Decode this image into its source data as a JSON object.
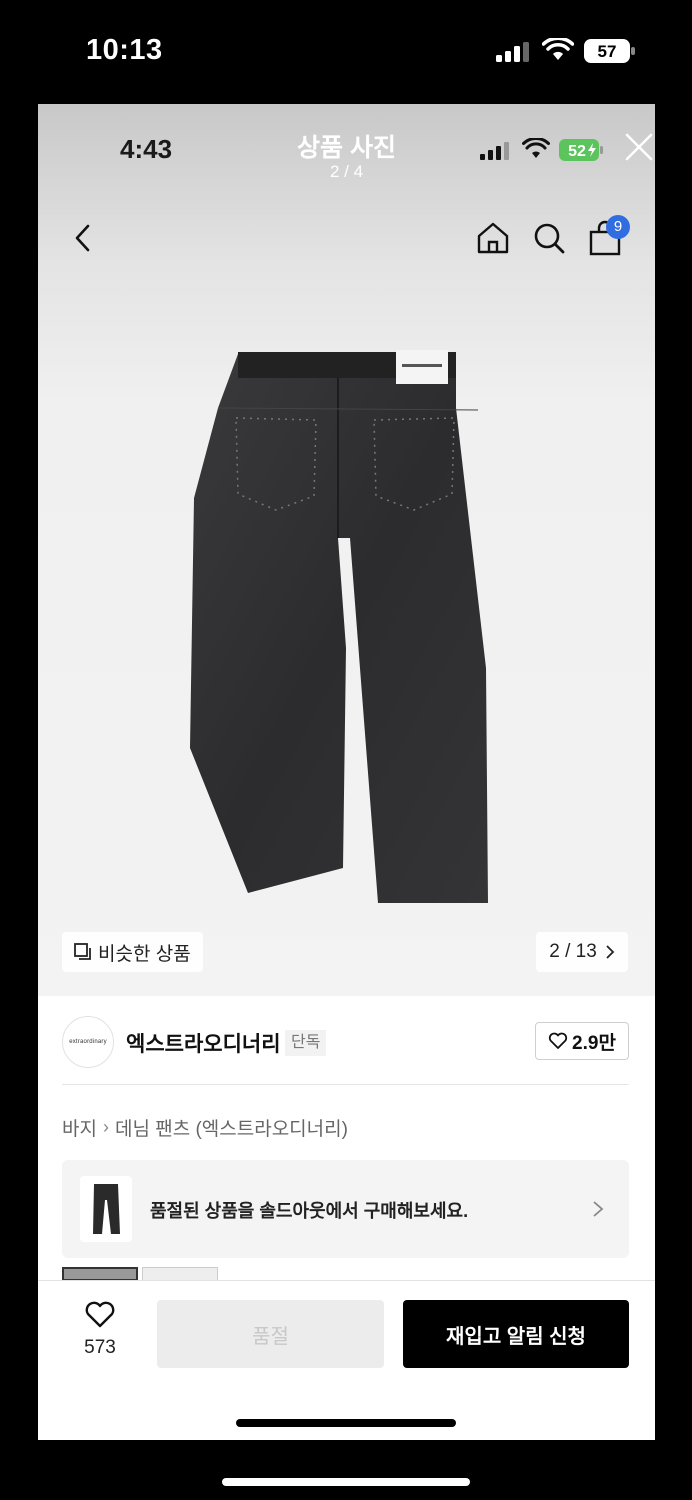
{
  "outer_status": {
    "time": "10:13",
    "battery": "57"
  },
  "inner_status": {
    "time": "4:43",
    "battery": "52"
  },
  "viewer": {
    "title": "상품 사진",
    "counter": "2 / 4"
  },
  "header": {
    "cart_count": "9"
  },
  "photo": {
    "similar_label": "비슷한 상품",
    "photo_counter": "2 / 13"
  },
  "brand": {
    "logo_text": "extraordinary",
    "name": "엑스트라오디너리",
    "tag": "단독",
    "likes": "2.9만"
  },
  "breadcrumb": [
    "바지",
    "데님 팬츠 (엑스트라오디너리)"
  ],
  "banner": {
    "text": "품절된 상품을 솔드아웃에서 구매해보세요."
  },
  "bottom": {
    "wish_count": "573",
    "soldout_label": "품절",
    "restock_label": "재입고 알림 신청"
  },
  "colors": {
    "badge": "#2f6de0",
    "primary_button": "#000000",
    "disabled_button": "#ececec"
  },
  "icons": [
    "signal-icon",
    "wifi-icon",
    "battery-icon",
    "close-icon",
    "back-icon",
    "home-icon",
    "search-icon",
    "bag-icon",
    "similar-icon",
    "chevron-right-icon",
    "heart-icon"
  ]
}
